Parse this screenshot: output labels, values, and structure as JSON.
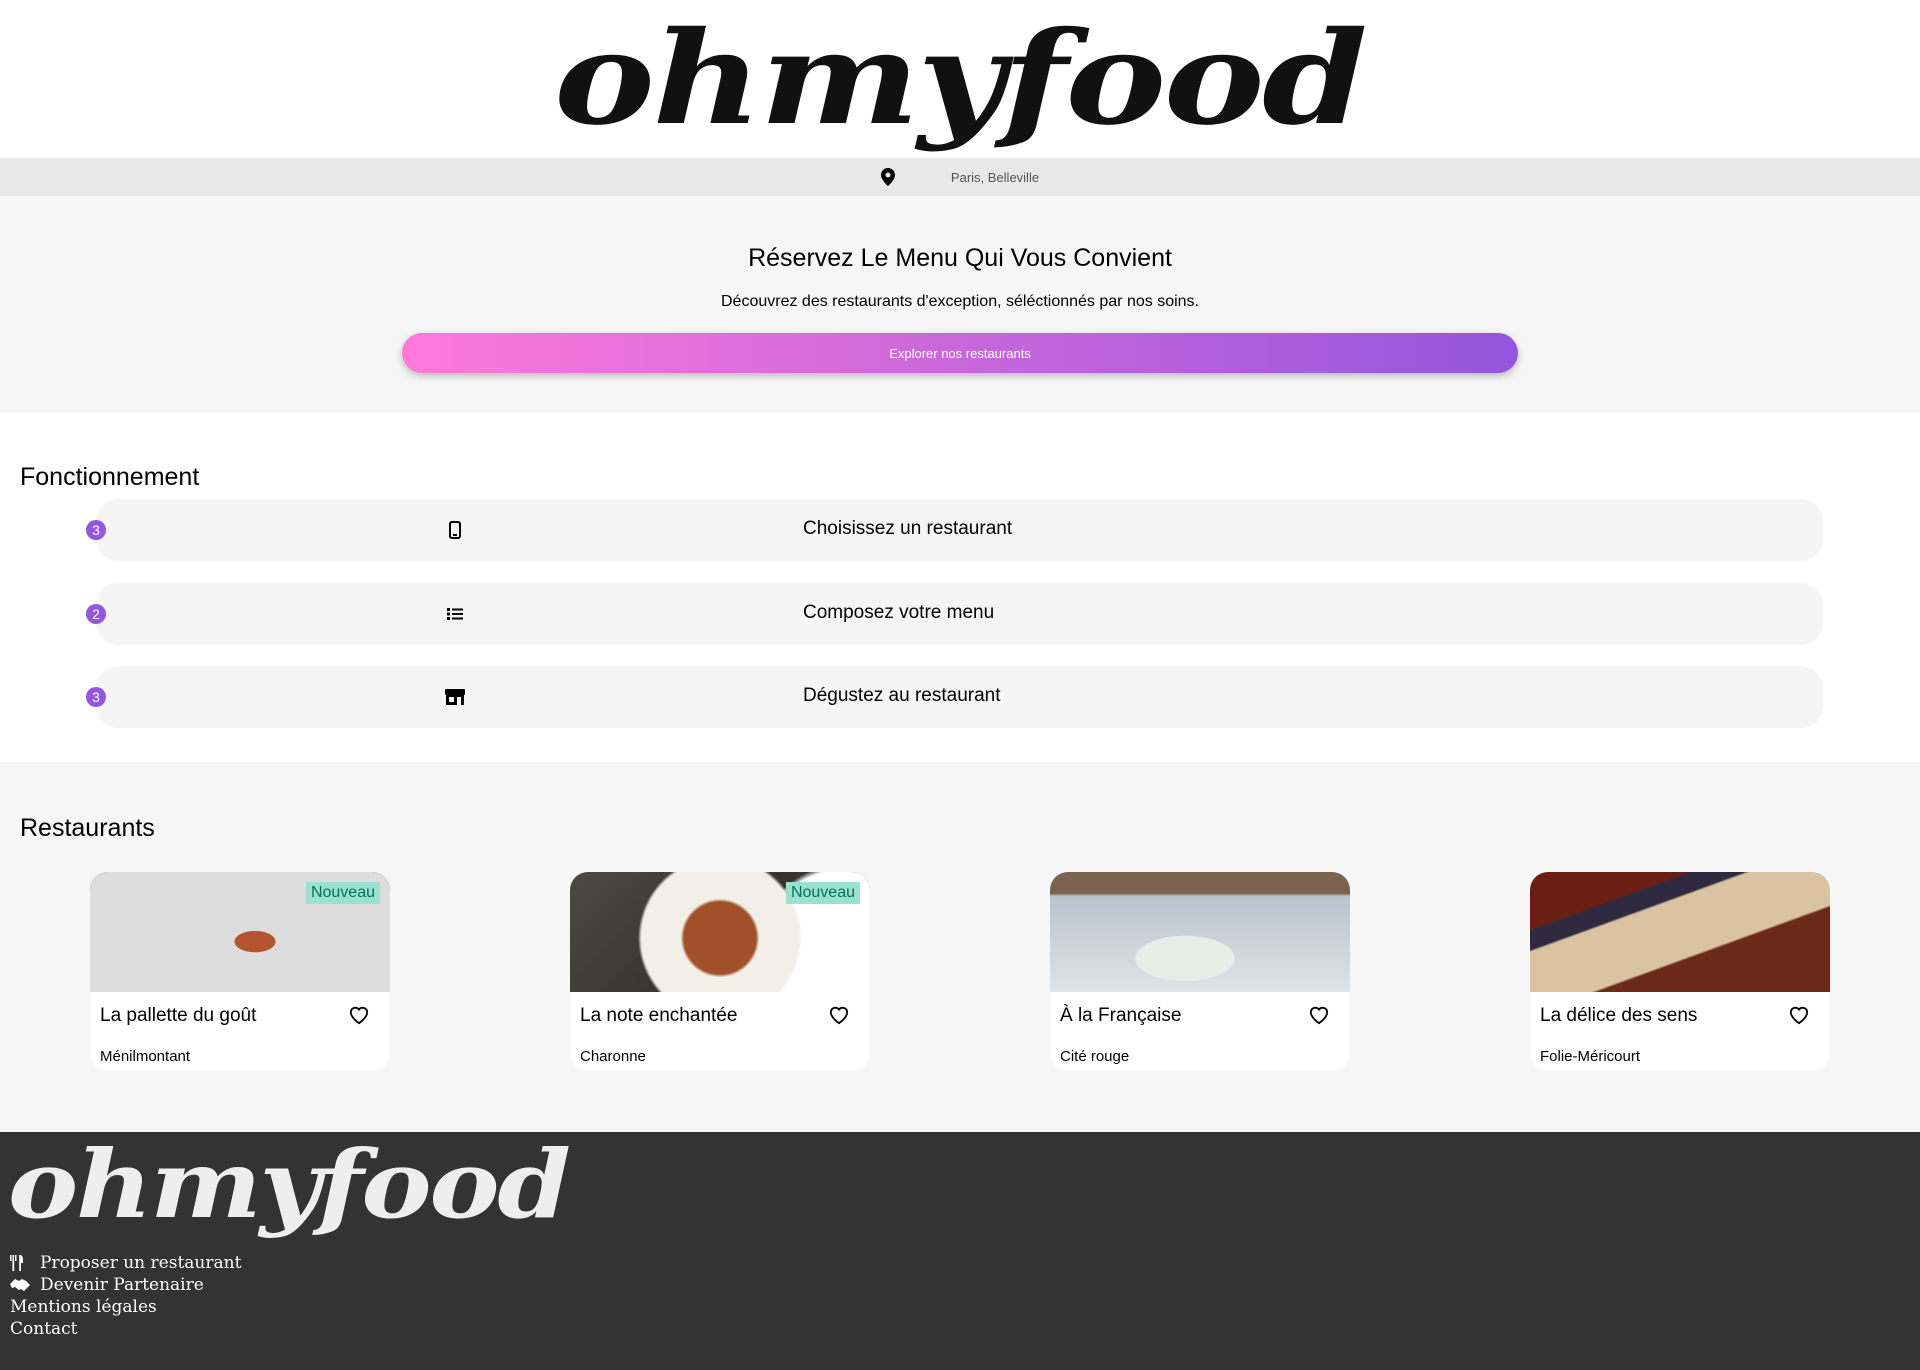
{
  "header": {
    "logo": "ohmyfood"
  },
  "location": {
    "icon": "map-pin-icon",
    "text": "Paris, Belleville"
  },
  "hero": {
    "title": "Réservez Le Menu Qui Vous Convient",
    "subtitle": "Découvrez des restaurants d'exception, séléctionnés par nos soins.",
    "button": "Explorer nos restaurants",
    "gradient": [
      "#ff79da",
      "#9356dc"
    ]
  },
  "how": {
    "title": "Fonctionnement",
    "steps": [
      {
        "number": "3",
        "icon": "mobile-phone-icon",
        "label": "Choisissez un restaurant"
      },
      {
        "number": "2",
        "icon": "list-icon",
        "label": "Composez votre menu"
      },
      {
        "number": "3",
        "icon": "store-icon",
        "label": "Dégustez au restaurant"
      }
    ]
  },
  "restaurants": {
    "title": "Restaurants",
    "items": [
      {
        "name": "La pallette du goût",
        "area": "Ménilmontant",
        "badge": "Nouveau"
      },
      {
        "name": "La note enchantée",
        "area": "Charonne",
        "badge": "Nouveau"
      },
      {
        "name": "À la Française",
        "area": "Cité rouge",
        "badge": ""
      },
      {
        "name": "La délice des sens",
        "area": "Folie-Méricourt",
        "badge": ""
      }
    ]
  },
  "footer": {
    "logo": "ohmyfood",
    "links": [
      {
        "icon": "utensils-icon",
        "label": "Proposer un restaurant"
      },
      {
        "icon": "handshake-icon",
        "label": "Devenir Partenaire"
      },
      {
        "icon": "",
        "label": "Mentions légales"
      },
      {
        "icon": "",
        "label": "Contact"
      }
    ]
  }
}
